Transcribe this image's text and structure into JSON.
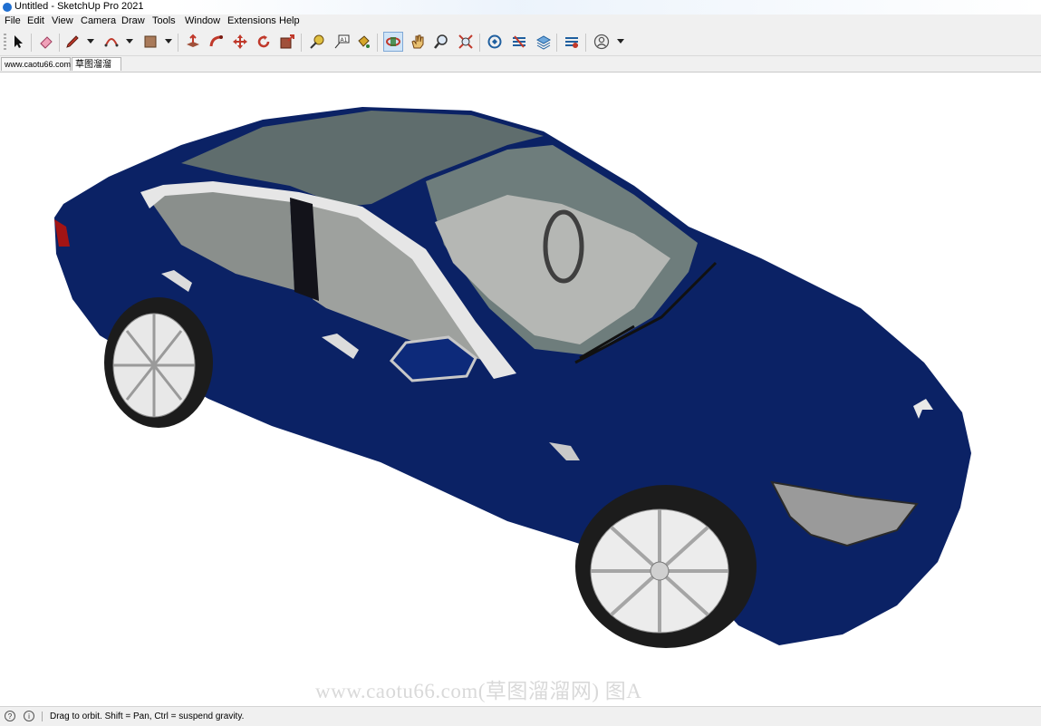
{
  "window": {
    "title": "Untitled - SketchUp Pro 2021"
  },
  "menu": {
    "items": [
      "File",
      "Edit",
      "View",
      "Camera",
      "Draw",
      "Tools",
      "Window",
      "Extensions",
      "Help"
    ]
  },
  "toolbar": {
    "tools": [
      "select-tool",
      "eraser-tool",
      "line-tool",
      "arc-tool",
      "shape-tool",
      "push-pull-tool",
      "follow-me-tool",
      "move-tool",
      "rotate-tool",
      "scale-tool",
      "tape-measure-tool",
      "text-tool",
      "paint-bucket-tool",
      "orbit-tool",
      "pan-tool",
      "zoom-tool",
      "zoom-extents-tool",
      "warehouse-tool",
      "extension-warehouse-tool",
      "layout-tool",
      "extension-manager-tool",
      "account-tool"
    ],
    "active_tool": "orbit-tool"
  },
  "scene_tabs": [
    {
      "label": "www.caotu66.com"
    },
    {
      "label": "草图溜溜网"
    }
  ],
  "viewport": {
    "watermark": "www.caotu66.com(草图溜溜网) 图A",
    "model_colors": {
      "body": "#0b2265",
      "glass": "#5f6d6d",
      "interior": "#b5b7b4",
      "wheel": "#e8e8e8",
      "tire": "#1c1c1c",
      "light": "#9a9a9a"
    }
  },
  "statusbar": {
    "message": "Drag to orbit. Shift = Pan, Ctrl = suspend gravity."
  }
}
